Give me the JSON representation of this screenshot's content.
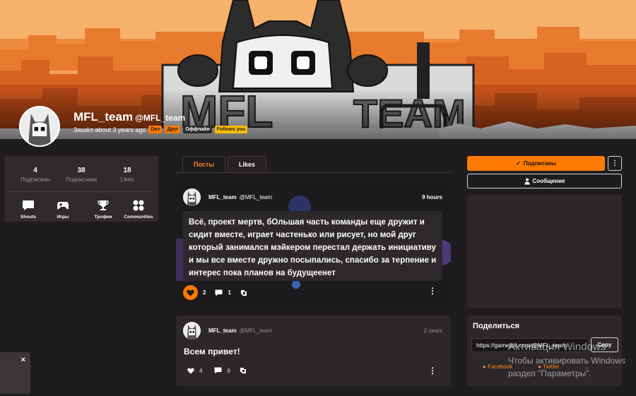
{
  "profile": {
    "name": "MFL_team",
    "handle": "@MFL_team",
    "last_seen": "Зашёл about 3 years ago",
    "tags": [
      "Dev",
      "Друг",
      "Оффлайн",
      "Follows you"
    ]
  },
  "stats": [
    {
      "value": "4",
      "label": "Подписаны"
    },
    {
      "value": "38",
      "label": "Подписчики"
    },
    {
      "value": "18",
      "label": "Likes"
    }
  ],
  "nav": [
    {
      "label": "Shouts",
      "icon": "chat-bubble-icon"
    },
    {
      "label": "Игры",
      "icon": "gamepad-icon"
    },
    {
      "label": "Трофеи",
      "icon": "trophy-icon"
    },
    {
      "label": "Communities",
      "icon": "communities-icon"
    }
  ],
  "toast": {
    "close": "×"
  },
  "tabs": [
    "Посты",
    "Likes"
  ],
  "posts": [
    {
      "user": "MFL_team",
      "handle": "@MFL_team",
      "time": "9 hours",
      "text": "Всё, проект мертв, бОльшая часть команды еще дружит и сидит вместе, играет частенько или рисует, но мой друг который занимался мэйкером перестал держать инициативу и мы все вместе дружно посыпались, спасибо за терпение и интерес пока планов на будущеенет",
      "likes": "2",
      "comments": "1"
    },
    {
      "user": "MFL_team",
      "handle": "@MFL_team",
      "time": "2 years",
      "text": "Всем привет!",
      "likes": "4",
      "comments": "6"
    }
  ],
  "actions": {
    "follow": "Подписаны",
    "more": "⋮",
    "message": "Сообщение"
  },
  "share": {
    "title": "Поделиться",
    "url": "https://gamejolt.com/@MFL_team",
    "copy": "Copy",
    "links": [
      "Facebook",
      "Twitter",
      "..."
    ]
  },
  "watermark": {
    "line1": "Активация Windows",
    "line2": "Чтобы активировать Windows",
    "line3": "раздел \"Параметры\"."
  },
  "colors": {
    "accent": "#ff7a00",
    "background": "#1f1c1f",
    "card": "#2b272a"
  }
}
